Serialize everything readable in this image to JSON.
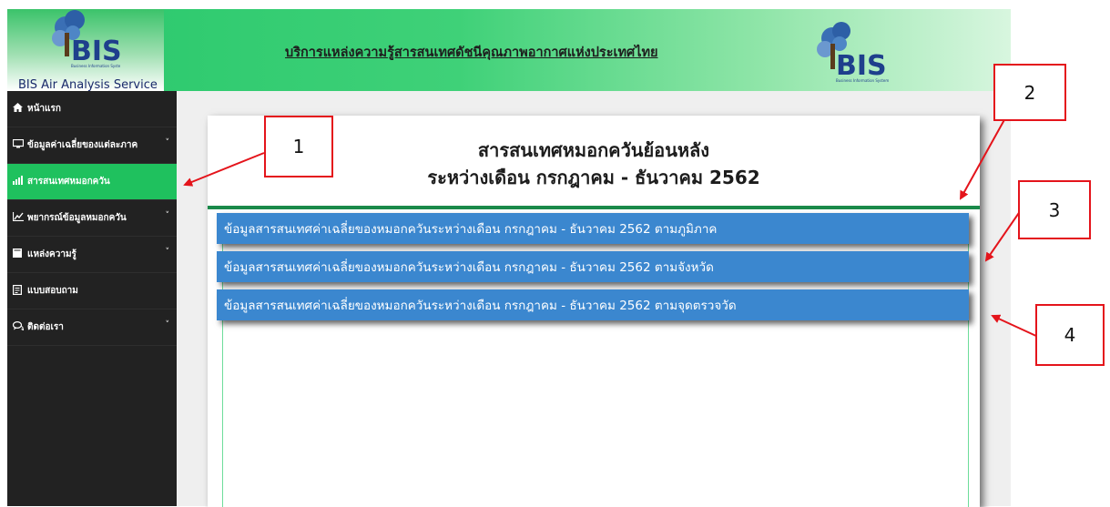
{
  "header": {
    "app_name": "BIS Air Analysis Service",
    "title": "บริการแหล่งความรู้สารสนเทศดัชนีคุณภาพอากาศแห่งประเทศไทย",
    "logo_text": "BIS",
    "logo_tagline": "Business Information System"
  },
  "sidebar": {
    "items": [
      {
        "label": "หน้าแรก",
        "icon": "home-icon",
        "has_submenu": false,
        "active": false
      },
      {
        "label": "ข้อมูลค่าเฉลี่ยของแต่ละภาค",
        "icon": "desktop-icon",
        "has_submenu": true,
        "active": false
      },
      {
        "label": "สารสนเทศหมอกควัน",
        "icon": "bar-chart-icon",
        "has_submenu": false,
        "active": true
      },
      {
        "label": "พยากรณ์ข้อมูลหมอกควัน",
        "icon": "line-chart-icon",
        "has_submenu": true,
        "active": false
      },
      {
        "label": "แหล่งความรู้",
        "icon": "book-icon",
        "has_submenu": true,
        "active": false
      },
      {
        "label": "แบบสอบถาม",
        "icon": "form-icon",
        "has_submenu": false,
        "active": false
      },
      {
        "label": "ติดต่อเรา",
        "icon": "chat-icon",
        "has_submenu": true,
        "active": false
      }
    ],
    "caret": "˅"
  },
  "main": {
    "heading_line1": "สารสนเทศหมอกควันย้อนหลัง",
    "heading_line2": "ระหว่างเดือน กรกฎาคม - ธันวาคม 2562",
    "links": [
      {
        "label": "ข้อมูลสารสนเทศค่าเฉลี่ยของหมอกควันระหว่างเดือน กรกฎาคม - ธันวาคม 2562 ตามภูมิภาค"
      },
      {
        "label": "ข้อมูลสารสนเทศค่าเฉลี่ยของหมอกควันระหว่างเดือน กรกฎาคม - ธันวาคม 2562 ตามจังหวัด"
      },
      {
        "label": "ข้อมูลสารสนเทศค่าเฉลี่ยของหมอกควันระหว่างเดือน กรกฎาคม - ธันวาคม 2562 ตามจุดตรวจวัด"
      }
    ]
  },
  "annotations": {
    "labels": [
      "1",
      "2",
      "3",
      "4"
    ],
    "color": "#e4141b"
  },
  "colors": {
    "header_green": "#27c76b",
    "sidebar_bg": "#222222",
    "active_item": "#1fc15e",
    "link_bar": "#3b87cf"
  }
}
